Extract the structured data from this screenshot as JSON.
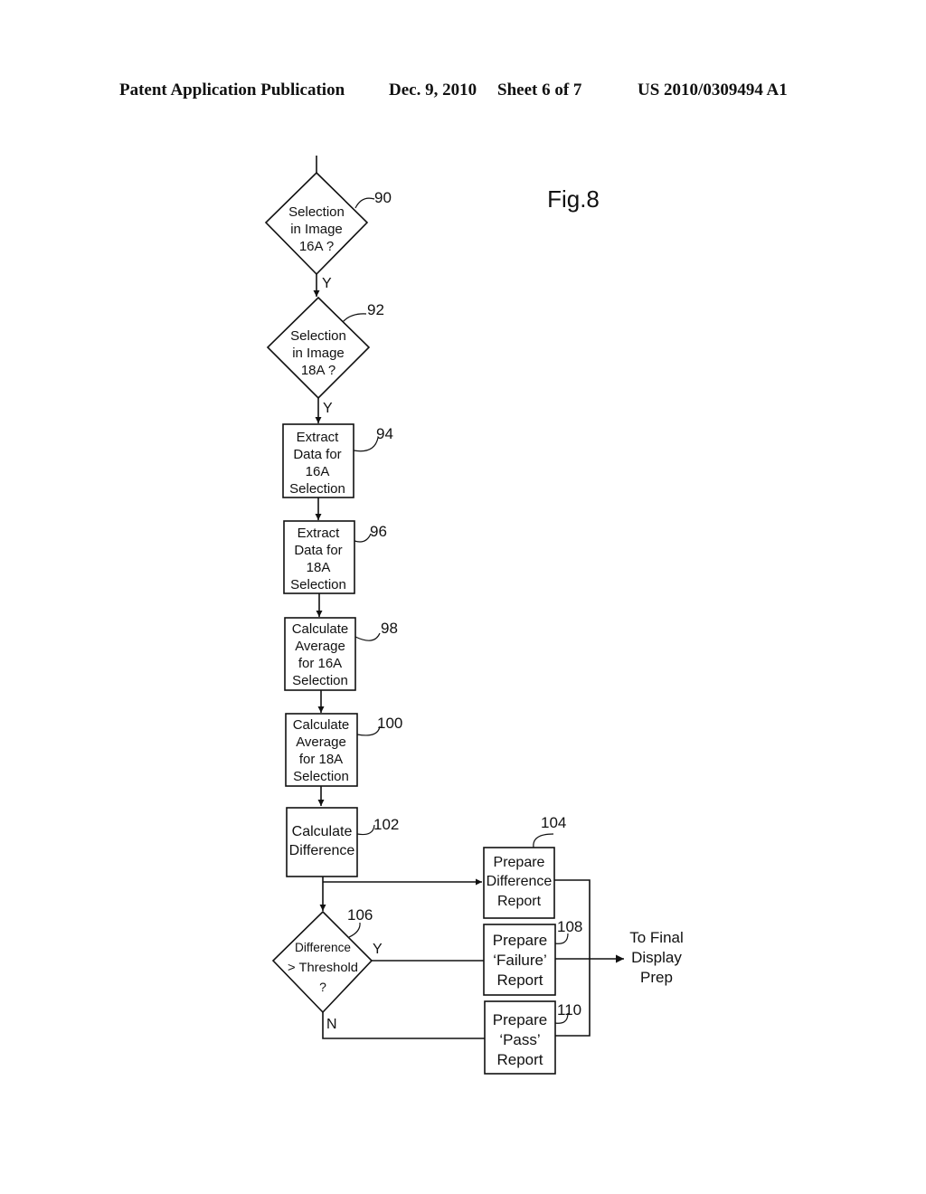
{
  "header": {
    "publication": "Patent Application Publication",
    "date": "Dec. 9, 2010",
    "sheet": "Sheet 6 of 7",
    "number": "US 2010/0309494 A1"
  },
  "figure_label": "Fig.8",
  "nodes": {
    "n90": {
      "ref": "90",
      "type": "decision",
      "lines": [
        "Selection",
        "in Image",
        "16A ?"
      ]
    },
    "n92": {
      "ref": "92",
      "type": "decision",
      "lines": [
        "Selection",
        "in Image",
        "18A ?"
      ]
    },
    "n94": {
      "ref": "94",
      "type": "process",
      "lines": [
        "Extract",
        "Data for",
        "16A",
        "Selection"
      ]
    },
    "n96": {
      "ref": "96",
      "type": "process",
      "lines": [
        "Extract",
        "Data for",
        "18A",
        "Selection"
      ]
    },
    "n98": {
      "ref": "98",
      "type": "process",
      "lines": [
        "Calculate",
        "Average",
        "for 16A",
        "Selection"
      ]
    },
    "n100": {
      "ref": "100",
      "type": "process",
      "lines": [
        "Calculate",
        "Average",
        "for 18A",
        "Selection"
      ]
    },
    "n102": {
      "ref": "102",
      "type": "process",
      "lines": [
        "Calculate",
        "Difference"
      ]
    },
    "n104": {
      "ref": "104",
      "type": "process",
      "lines": [
        "Prepare",
        "Difference",
        "Report"
      ]
    },
    "n106": {
      "ref": "106",
      "type": "decision",
      "lines": [
        "Difference",
        "> Threshold",
        "?"
      ]
    },
    "n108": {
      "ref": "108",
      "type": "process",
      "lines": [
        "Prepare",
        "‘Failure’",
        "Report"
      ]
    },
    "n110": {
      "ref": "110",
      "type": "process",
      "lines": [
        "Prepare",
        "‘Pass’",
        "Report"
      ]
    }
  },
  "edge_labels": {
    "yes": "Y",
    "no": "N"
  },
  "output": {
    "lines": [
      "To Final",
      "Display",
      "Prep"
    ]
  }
}
